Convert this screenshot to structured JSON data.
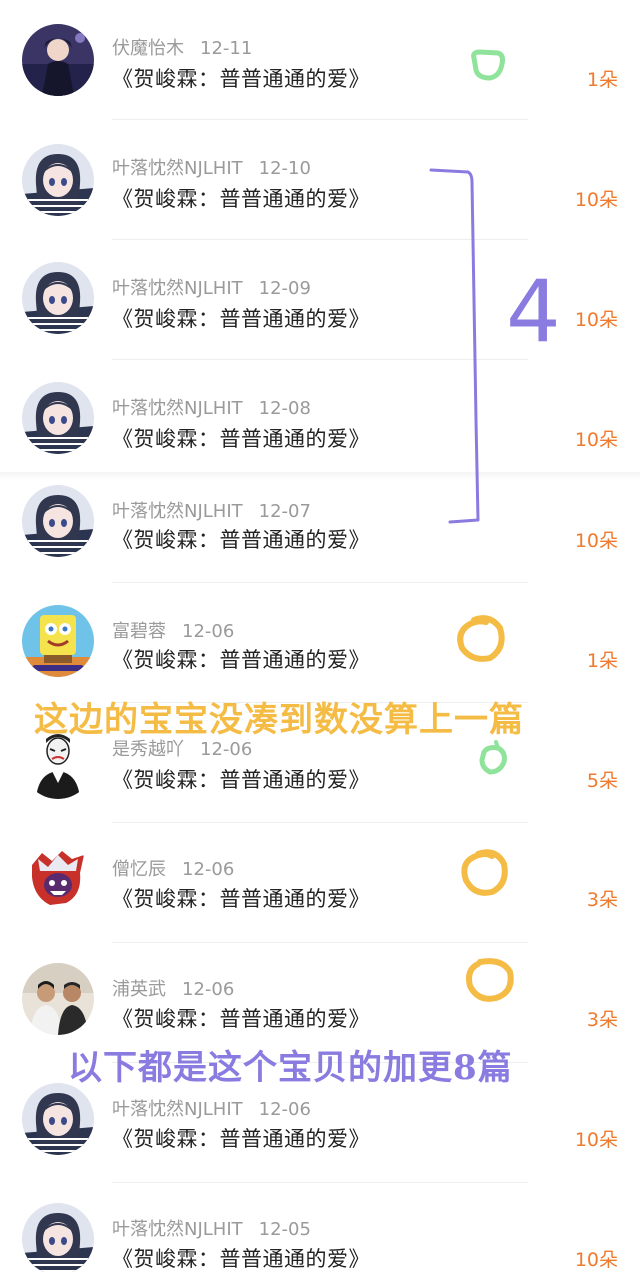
{
  "items": [
    {
      "user": "伏魔怡木",
      "date": "12-11",
      "title": "《贺峻霖：普普通通的爱》",
      "count": "1朵",
      "avatar": "dark-anime"
    },
    {
      "user": "叶落忱然NJLHIT",
      "date": "12-10",
      "title": "《贺峻霖：普普通通的爱》",
      "count": "10朵",
      "avatar": "anime-girl"
    },
    {
      "user": "叶落忱然NJLHIT",
      "date": "12-09",
      "title": "《贺峻霖：普普通通的爱》",
      "count": "10朵",
      "avatar": "anime-girl"
    },
    {
      "user": "叶落忱然NJLHIT",
      "date": "12-08",
      "title": "《贺峻霖：普普通通的爱》",
      "count": "10朵",
      "avatar": "anime-girl"
    },
    {
      "user": "叶落忱然NJLHIT",
      "date": "12-07",
      "title": "《贺峻霖：普普通通的爱》",
      "count": "10朵",
      "avatar": "anime-girl"
    },
    {
      "user": "富碧蓉",
      "date": "12-06",
      "title": "《贺峻霖：普普通通的爱》",
      "count": "1朵",
      "avatar": "sponge"
    },
    {
      "user": "是秀越吖",
      "date": "12-06",
      "title": "《贺峻霖：普普通通的爱》",
      "count": "5朵",
      "avatar": "masked-man"
    },
    {
      "user": "僧忆辰",
      "date": "12-06",
      "title": "《贺峻霖：普普通通的爱》",
      "count": "3朵",
      "avatar": "red-character"
    },
    {
      "user": "浦英武",
      "date": "12-06",
      "title": "《贺峻霖：普普通通的爱》",
      "count": "3朵",
      "avatar": "two-people"
    },
    {
      "user": "叶落忱然NJLHIT",
      "date": "12-06",
      "title": "《贺峻霖：普普通通的爱》",
      "count": "10朵",
      "avatar": "anime-girl"
    },
    {
      "user": "叶落忱然NJLHIT",
      "date": "12-05",
      "title": "《贺峻霖：普普通通的爱》",
      "count": "10朵",
      "avatar": "anime-girl"
    }
  ],
  "annotations": {
    "bracket_number": "4",
    "note_a": "这边的宝宝没凑到数没算上一篇",
    "note_b": "以下都是这个宝贝的加更8篇",
    "colors": {
      "purple": "#8a7be0",
      "yellow": "#f4bb45",
      "green": "#8fe39b",
      "count": "#f07a2e"
    }
  }
}
